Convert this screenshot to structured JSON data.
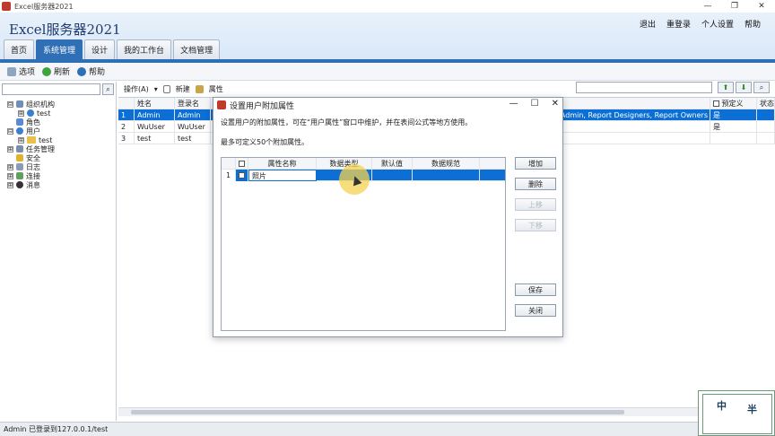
{
  "window": {
    "title": "Excel服务器2021",
    "controls": [
      "—",
      "❐",
      "✕"
    ]
  },
  "header": {
    "app_title": "Excel服务器2021",
    "links": [
      "退出",
      "重登录",
      "个人设置",
      "帮助"
    ],
    "tabs": [
      {
        "label": "首页",
        "active": false
      },
      {
        "label": "系统管理",
        "active": true
      },
      {
        "label": "设计",
        "active": false
      },
      {
        "label": "我的工作台",
        "active": false
      },
      {
        "label": "文档管理",
        "active": false
      }
    ]
  },
  "toolbar": {
    "options": "选项",
    "refresh": "刷新",
    "help": "帮助"
  },
  "tree": {
    "items": [
      {
        "label": "组织机构",
        "level": 0,
        "expander": "⊟"
      },
      {
        "label": "test",
        "level": 1,
        "expander": "⊞"
      },
      {
        "label": "角色",
        "level": 0,
        "expander": ""
      },
      {
        "label": "用户",
        "level": 0,
        "expander": "⊟"
      },
      {
        "label": "test",
        "level": 1,
        "expander": "⊞"
      },
      {
        "label": "任务管理",
        "level": 0,
        "expander": "⊞"
      },
      {
        "label": "安全",
        "level": 0,
        "expander": ""
      },
      {
        "label": "日志",
        "level": 0,
        "expander": "⊞"
      },
      {
        "label": "连接",
        "level": 0,
        "expander": "⊞"
      },
      {
        "label": "消息",
        "level": 0,
        "expander": "⊞"
      }
    ]
  },
  "main_toolbar": {
    "operations": "操作(A)",
    "new": "新建",
    "properties": "属性"
  },
  "grid": {
    "headers": [
      "姓名",
      "登录名",
      "预定义",
      "状态"
    ],
    "rows": [
      {
        "num": "1",
        "name": "Admin",
        "login": "Admin",
        "roles": "rocess Admin, Report Designers, Report Owners",
        "predefined": "是",
        "selected": true
      },
      {
        "num": "2",
        "name": "WuUser",
        "login": "WuUser",
        "roles": "",
        "predefined": "是",
        "selected": false
      },
      {
        "num": "3",
        "name": "test",
        "login": "test",
        "roles": "",
        "predefined": "",
        "selected": false
      }
    ]
  },
  "status": {
    "text": "Admin 已登录到127.0.0.1/test"
  },
  "dialog": {
    "title": "设置用户附加属性",
    "desc": "设置用户的附加属性，可在“用户属性”窗口中维护，并在表间公式等地方使用。",
    "desc2": "最多可定义50个附加属性。",
    "headers": [
      "属性名称",
      "数据类型",
      "默认值",
      "数据规范"
    ],
    "rows": [
      {
        "num": "1",
        "name": "照片",
        "type": "",
        "default": "",
        "spec": ""
      }
    ],
    "buttons": {
      "add": "增加",
      "delete": "删除",
      "up": "上移",
      "down": "下移",
      "save": "保存",
      "close": "关闭"
    }
  },
  "stamp": {
    "chars": [
      "中",
      "半"
    ]
  },
  "colors": {
    "accent": "#2f6fb5",
    "selection": "#0b6fd6"
  }
}
